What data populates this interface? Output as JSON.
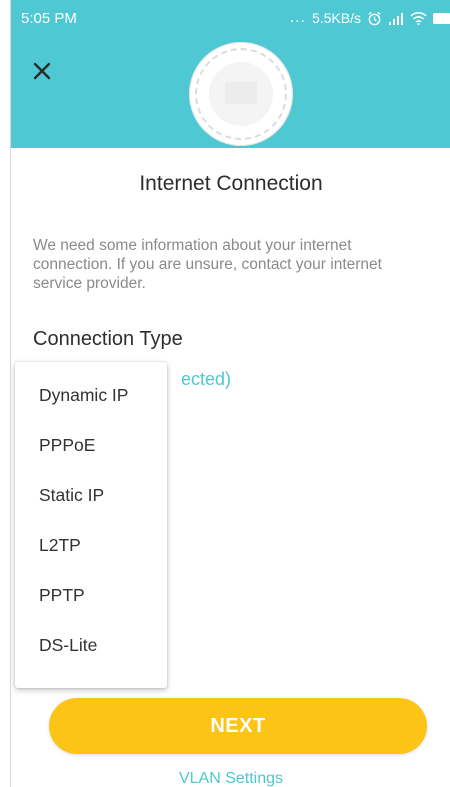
{
  "status_bar": {
    "time": "5:05 PM",
    "dots": "...",
    "speed": "5.5KB/s"
  },
  "header": {
    "close_icon": "close-icon",
    "device_image": "router-device"
  },
  "page": {
    "title": "Internet Connection",
    "description": "We need some information about your internet connection. If you are unsure, contact your internet service provider."
  },
  "connection": {
    "label": "Connection Type",
    "selected_partial": "ected)"
  },
  "dropdown": {
    "items": [
      "Dynamic IP",
      "PPPoE",
      "Static IP",
      "L2TP",
      "PPTP",
      "DS-Lite"
    ]
  },
  "buttons": {
    "next_label": "NEXT",
    "vlan_label": "VLAN Settings"
  },
  "colors": {
    "accent": "#4ec8d2",
    "button": "#fbc417",
    "text_secondary": "#8a8a8a"
  }
}
